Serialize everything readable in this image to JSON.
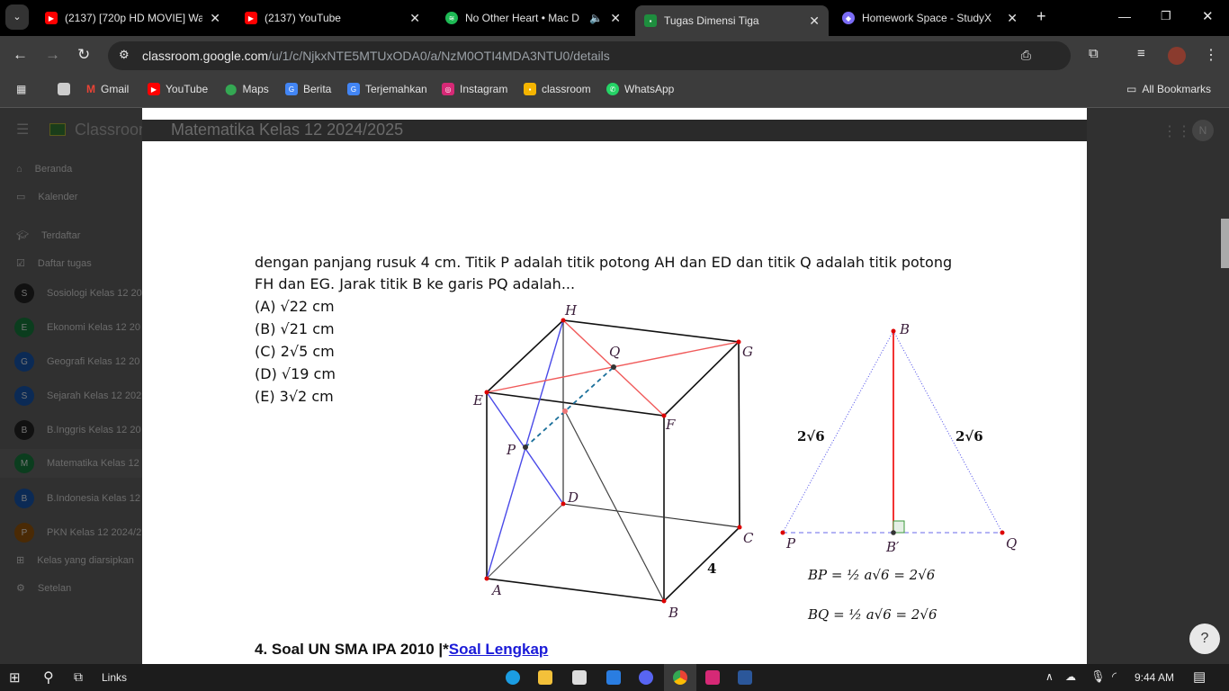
{
  "tabs": [
    {
      "title": "(2137) [720p HD MOVIE] Wa",
      "icon": "youtube-icon"
    },
    {
      "title": "(2137) YouTube",
      "icon": "youtube-icon"
    },
    {
      "title": "No Other Heart • Mac D",
      "icon": "spotify-icon",
      "audio": true
    },
    {
      "title": "Tugas Dimensi Tiga",
      "icon": "classroom-icon",
      "active": true
    },
    {
      "title": "Homework Space - StudyX",
      "icon": "studyx-icon"
    }
  ],
  "address": {
    "host": "classroom.google.com",
    "path": "/u/1/c/NjkxNTE5MTUxODA0/a/NzM0OTI4MDA3NTU0/details"
  },
  "bookmarks": [
    "Gmail",
    "YouTube",
    "Maps",
    "Berita",
    "Terjemahkan",
    "Instagram",
    "classroom",
    "WhatsApp"
  ],
  "all_bookmarks": "All Bookmarks",
  "classroom": {
    "app": "Classroom",
    "breadcrumb": "Matematika Kelas 12 2024/2025",
    "avatar": "N"
  },
  "sidebar": {
    "nav": [
      "Beranda",
      "Kalender"
    ],
    "enrolled": "Terdaftar",
    "todo": "Daftar tugas",
    "classes": [
      {
        "initial": "S",
        "name": "Sosiologi Kelas 12 20",
        "color": "#111111"
      },
      {
        "initial": "E",
        "name": "Ekonomi Kelas 12 20",
        "color": "#0b3d1e"
      },
      {
        "initial": "G",
        "name": "Geografi Kelas 12 20",
        "color": "#0b2a55"
      },
      {
        "initial": "S",
        "name": "Sejarah Kelas 12 202",
        "color": "#0b2a55"
      },
      {
        "initial": "B",
        "name": "B.Inggris Kelas 12 20",
        "color": "#111111"
      },
      {
        "initial": "M",
        "name": "Matematika Kelas 12",
        "color": "#0b3d1e"
      },
      {
        "initial": "B",
        "name": "B.Indonesia Kelas 12",
        "color": "#0b2a55"
      },
      {
        "initial": "P",
        "name": "PKN Kelas 12 2024/2",
        "color": "#4a2a05"
      }
    ],
    "archived": "Kelas yang diarsipkan",
    "settings": "Setelan"
  },
  "question": {
    "line1": "dengan panjang rusuk 4 cm. Titik P adalah titik potong AH dan ED dan titik Q adalah titik potong",
    "line2": "FH dan EG. Jarak titik B ke garis PQ adalah...",
    "options": [
      "(A) √22 cm",
      "(B) √21 cm",
      "(C) 2√5 cm",
      "(D) √19 cm",
      "(E) 3√2 cm"
    ]
  },
  "cube": {
    "labels": {
      "H": "H",
      "G": "G",
      "E": "E",
      "F": "F",
      "D": "D",
      "C": "C",
      "A": "A",
      "B": "B",
      "P": "P",
      "Q": "Q"
    },
    "edge_label": "4"
  },
  "triangle": {
    "B": "B",
    "P": "P",
    "Q": "Q",
    "Bp": "B′",
    "side_left": "2√6",
    "side_right": "2√6",
    "eq1": "BP = ½ a√6 = 2√6",
    "eq2": "BQ = ½ a√6 = 2√6"
  },
  "next": {
    "prefix": "4. Soal UN SMA IPA 2010 |*",
    "link": "Soal Lengkap"
  },
  "taskbar": {
    "search_label": "Links",
    "time": "9:44 AM"
  }
}
